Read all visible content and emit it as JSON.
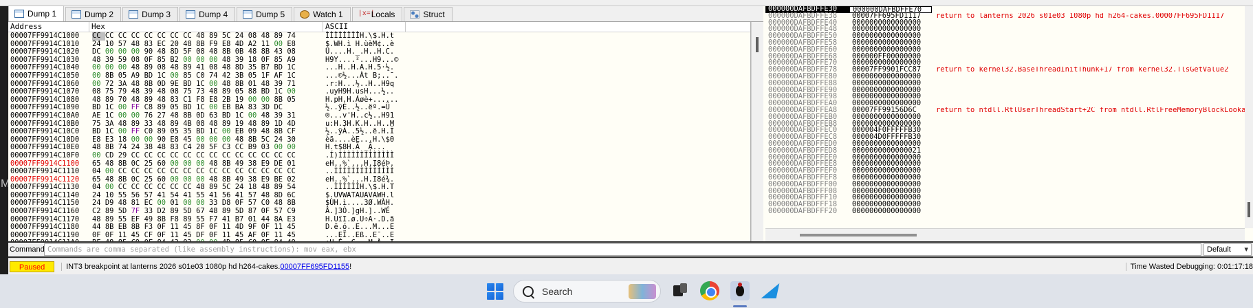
{
  "tabs": [
    {
      "label": "Dump 1",
      "icon": "dump-icon",
      "active": true
    },
    {
      "label": "Dump 2",
      "icon": "dump-icon"
    },
    {
      "label": "Dump 3",
      "icon": "dump-icon"
    },
    {
      "label": "Dump 4",
      "icon": "dump-icon"
    },
    {
      "label": "Dump 5",
      "icon": "dump-icon"
    },
    {
      "label": "Watch 1",
      "icon": "watch-icon"
    },
    {
      "label": "Locals",
      "icon": "locals-icon",
      "icon_text": "|x=|"
    },
    {
      "label": "Struct",
      "icon": "struct-icon"
    }
  ],
  "dump": {
    "headers": {
      "address": "Address",
      "hex": "Hex",
      "ascii": "ASCII"
    },
    "rows": [
      {
        "address": "00007FF9914C1000",
        "hex": "CC CC CC CC CC CC CC CC 48 89 5C 24 08 48 89 74",
        "ascii": "ÌÌÌÌÌÌÌÌH.\\$.H.t"
      },
      {
        "address": "00007FF9914C1010",
        "hex": "24 10 57 48 83 EC 20 48 8B F9 E8 4D A2 11 00 E8",
        "ascii": "$.WH.ì H.ùèM¢..è"
      },
      {
        "address": "00007FF9914C1020",
        "hex": "DC 00 00 00 90 48 8D 5F 08 48 8B 0B 48 8B 43 08",
        "ascii": "Ü....H._.H..H.C."
      },
      {
        "address": "00007FF9914C1030",
        "hex": "48 39 59 08 0F 85 B2 00 00 00 48 39 18 0F 85 A9",
        "ascii": "H9Y....²...H9...©"
      },
      {
        "address": "00007FF9914C1040",
        "hex": "00 00 00 48 89 08 48 89 41 08 48 8D 35 B7 BD 1C",
        "ascii": "...H..H.A.H.5·½."
      },
      {
        "address": "00007FF9914C1050",
        "hex": "00 8B 05 A9 BD 1C 00 85 C0 74 42 3B 05 1F AF 1C",
        "ascii": "...©½...Àt B;..¯."
      },
      {
        "address": "00007FF9914C1060",
        "hex": "00 72 3A 48 8B 0D 9E BD 1C 00 48 8B 01 48 39 71",
        "ascii": ".r:H...½..H..H9q"
      },
      {
        "address": "00007FF9914C1070",
        "hex": "08 75 79 48 39 48 08 75 73 48 89 05 88 BD 1C 00",
        "ascii": ".uyH9H.usH...½.."
      },
      {
        "address": "00007FF9914C1080",
        "hex": "48 89 70 48 89 48 83 C1 F8 E8 2B 19 00 00 8B 05",
        "ascii": "H.pH.H.Áøè+......"
      },
      {
        "address": "00007FF9914C1090",
        "hex": "BD 1C 00 FF C8 89 05 BD 1C 00 EB BA 83 3D DC",
        "ascii": "½..ÿÈ..½..ëº.=Ü"
      },
      {
        "address": "00007FF9914C10A0",
        "hex": "AE 1C 00 00 76 27 48 8B 0D 63 BD 1C 00 48 39 31",
        "ascii": "®...v'H..c½..H91"
      },
      {
        "address": "00007FF9914C10B0",
        "hex": "75 3A 48 89 33 48 89 4B 08 48 89 19 48 89 1D 4D",
        "ascii": "u:H.3H.K.H..H..M"
      },
      {
        "address": "00007FF9914C10C0",
        "hex": "BD 1C 00 FF C0 89 05 35 BD 1C 00 EB 09 48 8B CF",
        "ascii": "½..ÿÀ..5½..ë.H.Ï"
      },
      {
        "address": "00007FF9914C10D0",
        "hex": "E8 E3 18 00 00 90 E8 45 00 00 00 48 8B 5C 24 30",
        "ascii": "èã....èE...H.\\$0"
      },
      {
        "address": "00007FF9914C10E0",
        "hex": "48 8B 74 24 38 48 83 C4 20 5F C3 CC B9 03 00 00",
        "ascii": "H.t$8H.Ä _Ã̹..."
      },
      {
        "address": "00007FF9914C10F0",
        "hex": "00 CD 29 CC CC CC CC CC CC CC CC CC CC CC CC CC",
        "ascii": ".Í)ÌÌÌÌÌÌÌÌÌÌÌÌÌ"
      },
      {
        "address": "00007FF9914C1100",
        "hex": "65 48 8B 0C 25 60 00 00 00 48 8B 49 38 E9 DE 01",
        "ascii": "eH..%`...H.I8éÞ."
      },
      {
        "address": "00007FF9914C1110",
        "hex": "04 00 CC CC CC CC CC CC CC CC CC CC CC CC CC CC",
        "ascii": "..ÌÌÌÌÌÌÌÌÌÌÌÌÌÌ"
      },
      {
        "address": "00007FF9914C1120",
        "hex": "65 48 8B 0C 25 60 00 00 00 48 8B 49 38 E9 BE 02",
        "ascii": "eH..%`...H.I8é¾."
      },
      {
        "address": "00007FF9914C1130",
        "hex": "04 00 CC CC CC CC CC CC 48 89 5C 24 18 48 89 54",
        "ascii": "..ÌÌÌÌÌÌH.\\$.H.T"
      },
      {
        "address": "00007FF9914C1140",
        "hex": "24 10 55 56 57 41 54 41 55 41 56 41 57 48 8D 6C",
        "ascii": "$.UVWATAUAVAWH.l"
      },
      {
        "address": "00007FF9914C1150",
        "hex": "24 D9 48 81 EC 00 01 00 00 33 D8 0F 57 C0 48 8B",
        "ascii": "$ÙH.ì....3Ø.WÀH."
      },
      {
        "address": "00007FF9914C1160",
        "hex": "C2 89 5D 7F 33 D2 89 5D 67 48 89 5D 87 0F 57 C9",
        "ascii": "Â.]3Ò.]gH.]..WÉ"
      },
      {
        "address": "00007FF9914C1170",
        "hex": "48 89 55 EF 49 8B F8 89 55 F7 41 B7 01 44 8A E3",
        "ascii": "H.UïI.ø.U÷A·.D.ã"
      },
      {
        "address": "00007FF9914C1180",
        "hex": "44 8B EB 8B F3 0F 11 45 8F 0F 11 4D 9F 0F 11 45",
        "ascii": "D.ë.ó..E...M...E"
      },
      {
        "address": "00007FF9914C1190",
        "hex": "0F 0F 11 45 CF 0F 11 45 DF 0F 11 45 AF 0F 11 45",
        "ascii": "...EÏ..Eß..E¯..E"
      },
      {
        "address": "00007FF9914C11A0",
        "hex": "BF 48 85 C9 0F 84 43 03 00 00 4D 85 C0 0F 84 49",
        "ascii": "¿H.É..C...M.À..I"
      },
      {
        "address": "00007FF9914C11B0",
        "hex": "03 00 00 48 85 D2 0F 84 40 03 00 00 48 8B C2 BE",
        "ascii": "...H.Ò..@...H.Â¾"
      }
    ]
  },
  "stack": {
    "header_value": "000000DAFBDFFE70",
    "rows": [
      {
        "address": "000000DAFBDFFE30",
        "value": "000000DAFBDFFE70",
        "comment": ""
      },
      {
        "address": "000000DAFBDFFE38",
        "value": "00007FF695FD1117",
        "comment": "return to lanterns 2026 s01e03 1080p hd h264-cakes.00007FF695FD1117"
      },
      {
        "address": "000000DAFBDFFE40",
        "value": "0000000000000000",
        "comment": ""
      },
      {
        "address": "000000DAFBDFFE48",
        "value": "0000000000000000",
        "comment": ""
      },
      {
        "address": "000000DAFBDFFE50",
        "value": "0000000000000000",
        "comment": ""
      },
      {
        "address": "000000DAFBDFFE58",
        "value": "0000000000000000",
        "comment": ""
      },
      {
        "address": "000000DAFBDFFE60",
        "value": "0000000000000000",
        "comment": ""
      },
      {
        "address": "000000DAFBDFFE68",
        "value": "000000FF00000000",
        "comment": ""
      },
      {
        "address": "000000DAFBDFFE70",
        "value": "0000000000000000",
        "comment": ""
      },
      {
        "address": "000000DAFBDFFE78",
        "value": "00007FF9901FCC87",
        "comment": "return to kernel32.BaseThreadInitThunk+17 from kernel32.TlsGetValue2"
      },
      {
        "address": "000000DAFBDFFE80",
        "value": "0000000000000000",
        "comment": ""
      },
      {
        "address": "000000DAFBDFFE88",
        "value": "0000000000000000",
        "comment": ""
      },
      {
        "address": "000000DAFBDFFE90",
        "value": "0000000000000000",
        "comment": ""
      },
      {
        "address": "000000DAFBDFFE98",
        "value": "0000000000000000",
        "comment": ""
      },
      {
        "address": "000000DAFBDFFEA0",
        "value": "0000000000000000",
        "comment": ""
      },
      {
        "address": "000000DAFBDFFEA8",
        "value": "00007FF99156D6C",
        "comment": "return to ntdll.RtlUserThreadStart+2C from ntdll.RtlFreeMemoryBlockLookaside"
      },
      {
        "address": "000000DAFBDFFEB0",
        "value": "0000000000000000",
        "comment": ""
      },
      {
        "address": "000000DAFBDFFEB8",
        "value": "0000000000000000",
        "comment": ""
      },
      {
        "address": "000000DAFBDFFEC0",
        "value": "000004F0FFFFFB30",
        "comment": ""
      },
      {
        "address": "000000DAFBDFFEC8",
        "value": "000004D0FFFFFB30",
        "comment": ""
      },
      {
        "address": "000000DAFBDFFED0",
        "value": "0000000000000000",
        "comment": ""
      },
      {
        "address": "000000DAFBDFFED8",
        "value": "0000000000000021",
        "comment": ""
      },
      {
        "address": "000000DAFBDFFEE0",
        "value": "0000000000000000",
        "comment": ""
      },
      {
        "address": "000000DAFBDFFEE8",
        "value": "0000000000000000",
        "comment": ""
      },
      {
        "address": "000000DAFBDFFEF0",
        "value": "0000000000000000",
        "comment": ""
      },
      {
        "address": "000000DAFBDFFEF8",
        "value": "0000000000000000",
        "comment": ""
      },
      {
        "address": "000000DAFBDFFF00",
        "value": "0000000000000000",
        "comment": ""
      },
      {
        "address": "000000DAFBDFFF08",
        "value": "0000000000000000",
        "comment": ""
      },
      {
        "address": "000000DAFBDFFF10",
        "value": "0000000000000000",
        "comment": ""
      },
      {
        "address": "000000DAFBDFFF18",
        "value": "0000000000000000",
        "comment": ""
      },
      {
        "address": "000000DAFBDFFF20",
        "value": "0000000000000000",
        "comment": ""
      }
    ]
  },
  "command": {
    "label": "Command:",
    "placeholder": "Commands are comma separated (like assembly instructions): mov eax, ebx",
    "mode": "Default"
  },
  "status": {
    "state": "Paused",
    "message_prefix": "INT3 breakpoint at lanterns 2026 s01e03 1080p hd h264-cakes.",
    "message_link": "00007FF695FD1155",
    "message_suffix": "!",
    "time_wasted": "Time Wasted Debugging: 0:01:17:18"
  },
  "taskbar": {
    "search_label": "Search",
    "apps": [
      "start-icon",
      "task-view-icon",
      "chrome-icon",
      "x64dbg-icon",
      "app-icon"
    ]
  },
  "colors": {
    "accent_red": "#e00000",
    "paused_bg": "#ffea00",
    "link": "#0000ee",
    "ascii_green": "#2a8a2a",
    "ascii_purple": "#8000a0"
  }
}
